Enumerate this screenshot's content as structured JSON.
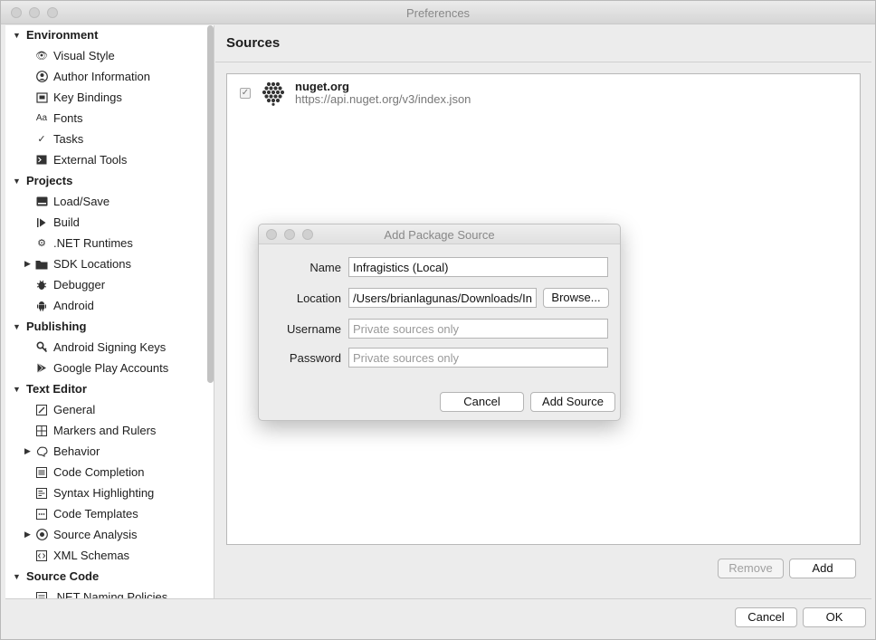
{
  "window": {
    "title": "Preferences"
  },
  "sidebar": {
    "sections": [
      {
        "label": "Environment",
        "items": [
          "Visual Style",
          "Author Information",
          "Key Bindings",
          "Fonts",
          "Tasks",
          "External Tools"
        ]
      },
      {
        "label": "Projects",
        "items": [
          "Load/Save",
          "Build",
          ".NET Runtimes",
          "SDK Locations",
          "Debugger",
          "Android"
        ]
      },
      {
        "label": "Publishing",
        "items": [
          "Android Signing Keys",
          "Google Play Accounts"
        ]
      },
      {
        "label": "Text Editor",
        "items": [
          "General",
          "Markers and Rulers",
          "Behavior",
          "Code Completion",
          "Syntax Highlighting",
          "Code Templates",
          "Source Analysis",
          "XML Schemas"
        ]
      },
      {
        "label": "Source Code",
        "items": [
          ".NET Naming Policies"
        ]
      }
    ]
  },
  "main": {
    "title": "Sources",
    "sources": [
      {
        "name": "nuget.org",
        "url": "https://api.nuget.org/v3/index.json",
        "enabled": true
      }
    ],
    "remove_label": "Remove",
    "add_label": "Add"
  },
  "footer": {
    "cancel_label": "Cancel",
    "ok_label": "OK"
  },
  "dialog": {
    "title": "Add Package Source",
    "name_label": "Name",
    "name_value": "Infragistics (Local)",
    "location_label": "Location",
    "location_value": "/Users/brianlagunas/Downloads/Infr",
    "browse_label": "Browse...",
    "username_label": "Username",
    "username_placeholder": "Private sources only",
    "password_label": "Password",
    "password_placeholder": "Private sources only",
    "cancel_label": "Cancel",
    "add_source_label": "Add Source"
  }
}
